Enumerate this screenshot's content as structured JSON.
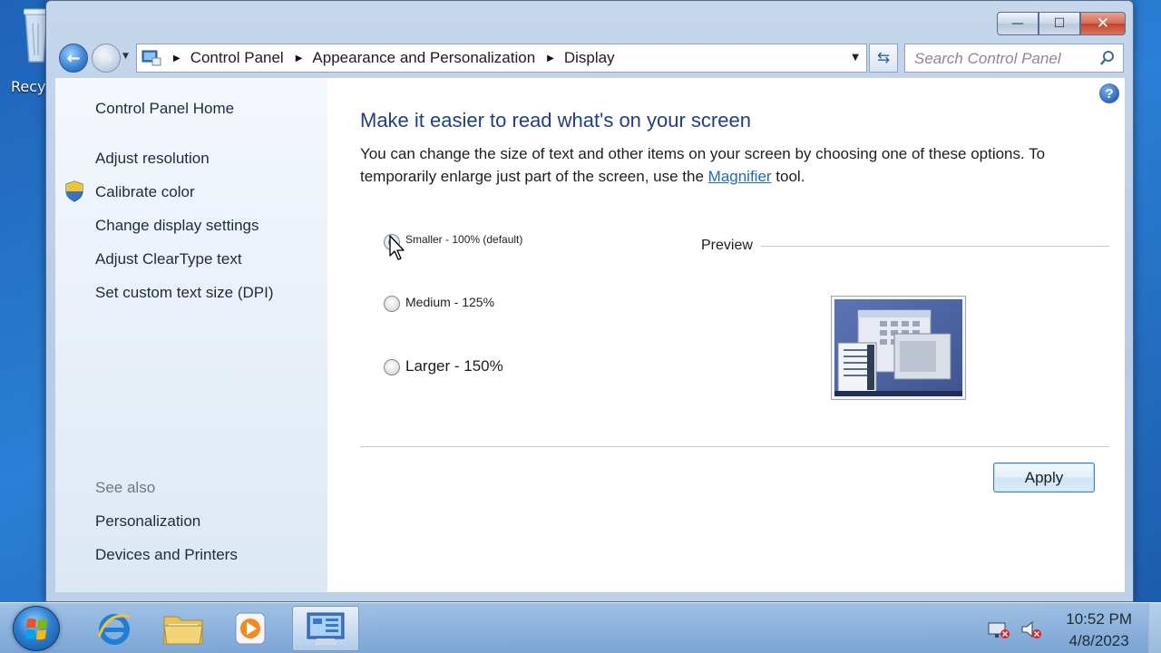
{
  "desktop": {
    "recycle_label": "Recy"
  },
  "window": {
    "caption": {
      "minimize": "—",
      "maximize": "☐",
      "close": "✕"
    },
    "address": {
      "crumbs": [
        "Control Panel",
        "Appearance and Personalization",
        "Display"
      ],
      "search_placeholder": "Search Control Panel"
    },
    "sidebar": {
      "home": "Control Panel Home",
      "tasks": [
        "Adjust resolution",
        "Calibrate color",
        "Change display settings",
        "Adjust ClearType text",
        "Set custom text size (DPI)"
      ],
      "see_also_heading": "See also",
      "see_also": [
        "Personalization",
        "Devices and Printers"
      ]
    },
    "main": {
      "title": "Make it easier to read what's on your screen",
      "desc_before": "You can change the size of text and other items on your screen by choosing one of these options. To temporarily enlarge just part of the screen, use the ",
      "desc_link": "Magnifier",
      "desc_after": " tool.",
      "options": [
        {
          "label": "Smaller - 100% (default)",
          "selected": true
        },
        {
          "label": "Medium - 125%",
          "selected": false
        },
        {
          "label": "Larger - 150%",
          "selected": false
        }
      ],
      "preview_label": "Preview",
      "apply": "Apply",
      "help": "?"
    }
  },
  "taskbar": {
    "clock_time": "10:52 PM",
    "clock_date": "4/8/2023"
  },
  "colors": {
    "title_blue": "#1f3e8c",
    "link_blue": "#1a6dba",
    "desktop_blue": "#2b7fd6"
  }
}
